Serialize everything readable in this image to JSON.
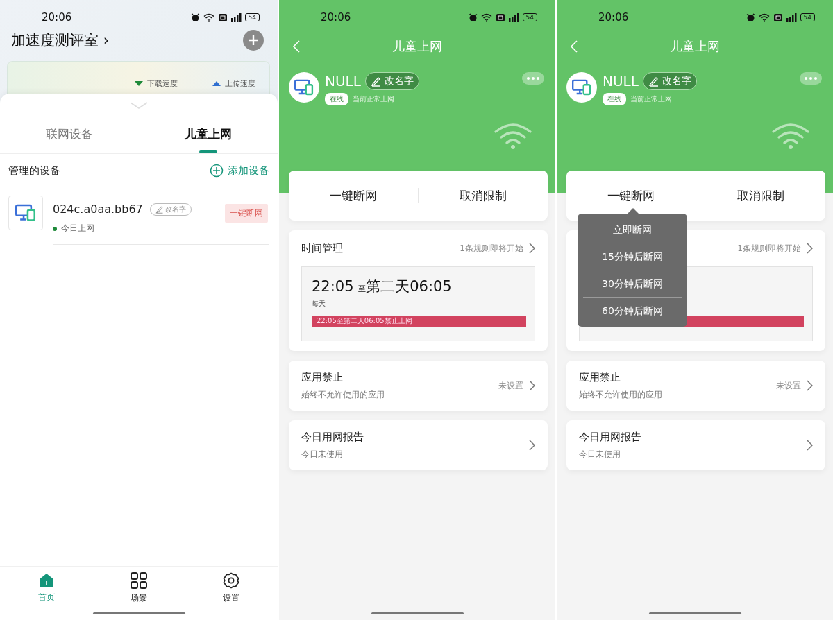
{
  "screens": [
    {
      "kind": "home",
      "status": {
        "time": "20:06",
        "battery": "54"
      },
      "header": {
        "title": "加速度测评室 ›"
      },
      "banner": {
        "download_label": "下载速度",
        "upload_label": "上传速度"
      },
      "tabs": [
        {
          "label": "联网设备",
          "selected": false
        },
        {
          "label": "儿童上网",
          "selected": true
        }
      ],
      "section": {
        "title": "管理的设备",
        "action": "添加设备"
      },
      "devices": [
        {
          "name": "024c.a0aa.bb67",
          "rename": "改名字",
          "online": true,
          "status": "今日上网",
          "action": "一键断网"
        }
      ],
      "nav": [
        {
          "kind": "home",
          "label": "首页",
          "selected": true
        },
        {
          "kind": "grid",
          "label": "场景",
          "selected": false
        },
        {
          "kind": "gear",
          "label": "设置",
          "selected": false
        }
      ]
    },
    {
      "kind": "detail",
      "status": {
        "time": "20:06",
        "battery": "54"
      },
      "title": "儿童上网",
      "device": {
        "name": "NULL",
        "rename": "改名字",
        "badge": "在线",
        "status": "当前正常上网"
      },
      "actions": [
        "一键断网",
        "取消限制"
      ],
      "time_card": {
        "title": "时间管理",
        "rule": "1条规则即将开始",
        "start": "22:05",
        "sep": "至",
        "end": "第二天06:05",
        "repeat": "每天",
        "bar_text": "22:05至第二天06:05禁止上网"
      },
      "rows": [
        {
          "title": "应用禁止",
          "subtitle": "始终不允许使用的应用",
          "value": "未设置"
        },
        {
          "title": "今日用网报告",
          "subtitle": "今日未使用"
        }
      ]
    },
    {
      "kind": "detail",
      "status": {
        "time": "20:06",
        "battery": "54"
      },
      "title": "儿童上网",
      "device": {
        "name": "NULL",
        "rename": "改名字",
        "badge": "在线",
        "status": "当前正常上网"
      },
      "actions": [
        "一键断网",
        "取消限制"
      ],
      "time_card": {
        "rule": "1条规则即将开始"
      },
      "rows": [
        {
          "title": "应用禁止",
          "subtitle": "始终不允许使用的应用",
          "value": "未设置"
        },
        {
          "title": "今日用网报告",
          "subtitle": "今日未使用"
        }
      ],
      "popup": {
        "items": [
          "立即断网",
          "15分钟后断网",
          "30分钟后断网",
          "60分钟后断网"
        ]
      }
    }
  ]
}
